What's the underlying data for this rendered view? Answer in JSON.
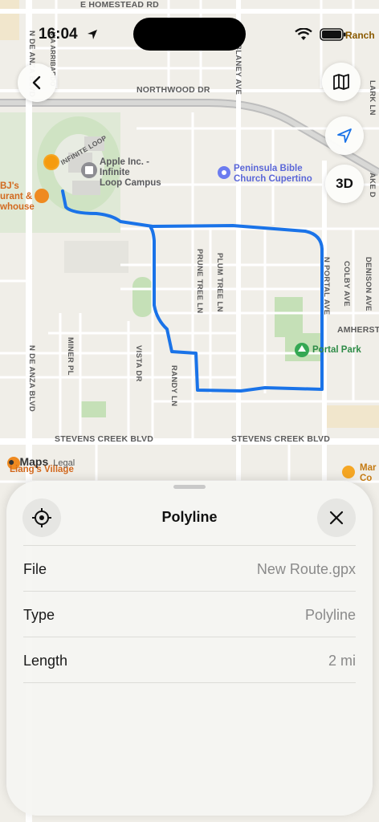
{
  "status_bar": {
    "time": "16:04",
    "carrier_fragment": "Ranch"
  },
  "map": {
    "streets": {
      "homestead": "E HOMESTEAD RD",
      "northwood": "NORTHWOOD DR",
      "infinite_loop": "INFINITE LOOP",
      "stevens_creek_left": "STEVENS CREEK BLVD",
      "stevens_creek_right": "STEVENS CREEK BLVD",
      "amherst": "AMHERST D",
      "de_anza": "N DE ANZA BLVD",
      "vallco_fragment": "VIA ARRIBARDO",
      "blaney": "N BLANEY AVE",
      "prune_tree": "PRUNE TREE LN",
      "plum_tree": "PLUM TREE LN",
      "portal": "N PORTAL AVE",
      "colby": "COLBY AVE",
      "denison": "DENISON AVE",
      "miner": "MINER PL",
      "vista": "VISTA DR",
      "randy": "RANDY LN",
      "lark_fragment": "LARK LN",
      "lake_fragment": "AKE D"
    },
    "pois": {
      "apple": "Apple Inc. -\nInfinite\nLoop Campus",
      "church": "Peninsula Bible\nChurch Cupertino",
      "park": "Portal Park",
      "bjs": "BJ's\nurant &\nwhouse",
      "liangs": "Liang's Village",
      "right_edge": "Mar\nCo"
    },
    "attribution": {
      "brand": "Maps",
      "legal": "Legal"
    },
    "route_color": "#1a73e8"
  },
  "controls": {
    "back_icon": "chevron-left-icon",
    "map_icon": "map-icon",
    "locate_icon": "location-arrow-icon",
    "view_3d_label": "3D"
  },
  "sheet": {
    "title": "Polyline",
    "rows": [
      {
        "key": "File",
        "value": "New Route.gpx"
      },
      {
        "key": "Type",
        "value": "Polyline"
      },
      {
        "key": "Length",
        "value": "2 mi"
      }
    ]
  }
}
